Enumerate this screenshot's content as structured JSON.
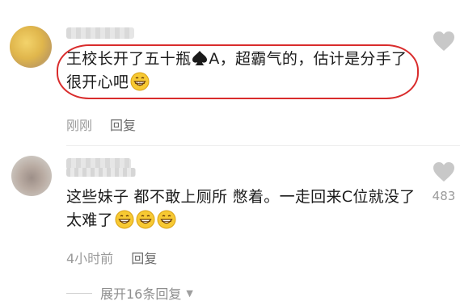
{
  "comments": [
    {
      "text_parts": [
        "王校长开了五十瓶",
        "A，超霸气的，估计是分手了很开心吧"
      ],
      "time": "刚刚",
      "reply_label": "回复",
      "like_count": ""
    },
    {
      "text": "这些妹子 都不敢上厕所 憋着。一走回来C位就没了 太难了",
      "time": "4小时前",
      "reply_label": "回复",
      "like_count": "483"
    }
  ],
  "expand_label": "展开16条回复",
  "icons": {
    "like": "heart-icon",
    "spade": "spade-suit-icon",
    "emoji": "grin-emoji-icon",
    "expand": "triangle-down-icon"
  },
  "colors": {
    "highlight": "#d92c2c",
    "meta_text": "#9a9a9a",
    "heart": "#c8c8c8"
  }
}
